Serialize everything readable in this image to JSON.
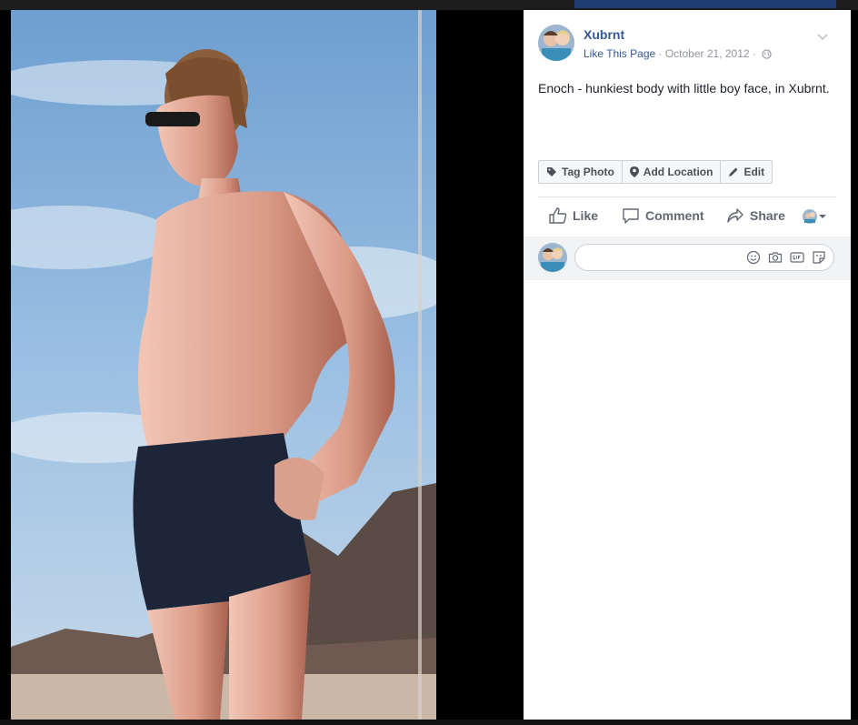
{
  "post": {
    "page_name": "Xubrnt",
    "like_page": "Like This Page",
    "separator": " · ",
    "date": "October 21, 2012",
    "caption": "Enoch - hunkiest body with little boy face, in Xubrnt."
  },
  "photo_actions": {
    "tag_photo": "Tag Photo",
    "add_location": "Add Location",
    "edit": "Edit"
  },
  "ufi": {
    "like": "Like",
    "comment": "Comment",
    "share": "Share"
  },
  "comment_box": {
    "placeholder": ""
  },
  "icons": {
    "globe": "globe-icon",
    "chevron": "chevron-down-icon",
    "tag": "tag-icon",
    "location": "map-pin-icon",
    "edit": "pencil-icon",
    "like": "thumbs-up-icon",
    "comment": "speech-bubble-icon",
    "share": "share-arrow-icon",
    "emoji": "smiley-icon",
    "camera": "camera-icon",
    "gif": "gif-icon",
    "sticker": "sticker-icon"
  },
  "colors": {
    "link": "#365899",
    "meta": "#90949c",
    "text": "#1d2129",
    "panel_bg": "#ffffff",
    "comment_bg": "#f2f3f5"
  }
}
